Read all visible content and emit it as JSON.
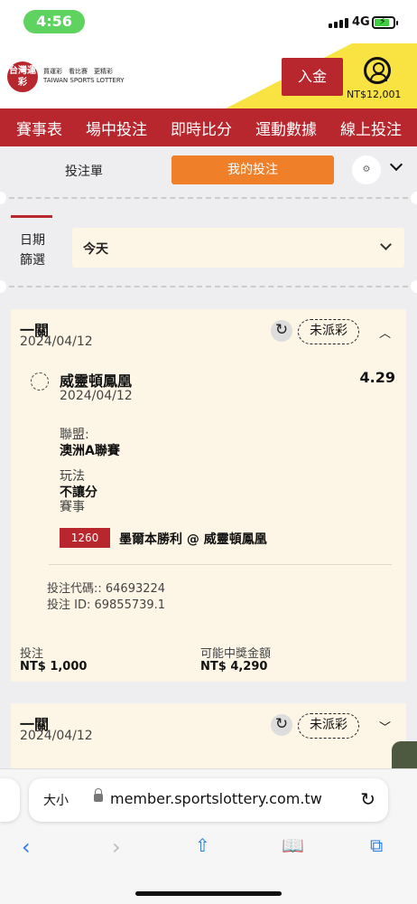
{
  "status": {
    "time": "4:56",
    "network": "4G"
  },
  "header": {
    "logo_text": "台灣運彩",
    "deposit_label": "入金",
    "balance": "NT$12,001"
  },
  "nav": {
    "items": [
      "賽事表",
      "場中投注",
      "即時比分",
      "運動數據",
      "線上投注"
    ]
  },
  "tabs": {
    "bet_slip": "投注單",
    "my_bets": "我的投注"
  },
  "filter": {
    "label": "日期篩選",
    "value": "今天"
  },
  "bets": [
    {
      "type": "一關",
      "date": "2024/04/12",
      "status": "未派彩",
      "selection": {
        "team": "威靈頓鳳凰",
        "date": "2024/04/12",
        "odds": "4.29",
        "league_label": "聯盟:",
        "league": "澳洲A聯賽",
        "market_label": "玩法",
        "market": "不讓分",
        "event_label": "賽事",
        "event_id": "1260",
        "event_name": "墨爾本勝利 @ 威靈頓鳳凰"
      },
      "bet_code": "投注代碼:: 64693224",
      "bet_id": "投注 ID: 69855739.1",
      "stake_label": "投注",
      "stake": "NT$ 1,000",
      "payout_label": "可能中獎金額",
      "payout": "NT$ 4,290"
    },
    {
      "type": "一關",
      "date": "2024/04/12",
      "status": "未派彩"
    }
  ],
  "browser": {
    "text_size": "大小",
    "url": "member.sportslottery.com.tw"
  },
  "colors": {
    "brand_red": "#b8262e",
    "orange": "#f07f2a",
    "cream": "#fdf6e6",
    "ios_blue": "#2c7be5"
  }
}
